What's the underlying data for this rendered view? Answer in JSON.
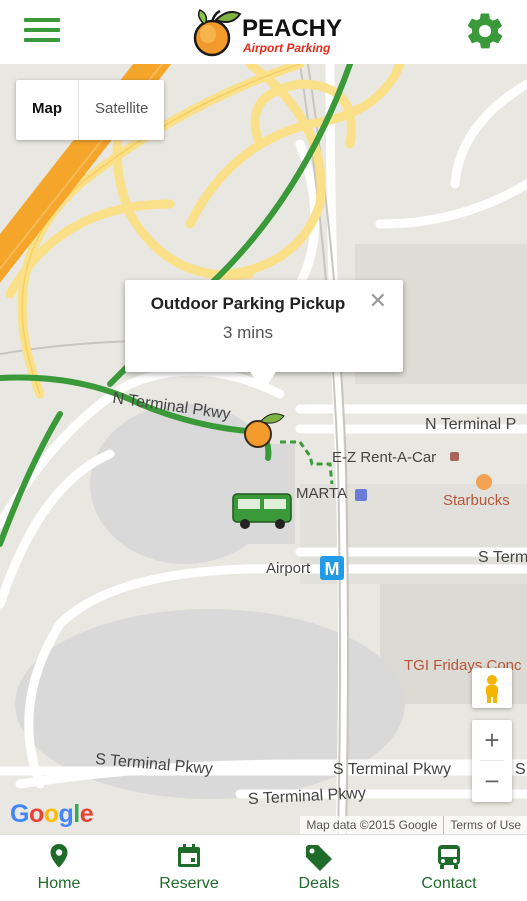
{
  "header": {
    "logo_title": "PEACHY",
    "logo_subtitle": "Airport Parking",
    "menu_icon": "hamburger-menu-icon",
    "settings_icon": "gear-icon"
  },
  "map": {
    "type_control": {
      "map_label": "Map",
      "satellite_label": "Satellite",
      "selected": "Map"
    },
    "popup": {
      "title": "Outdoor Parking Pickup",
      "subtitle": "3 mins",
      "close_label": "✕"
    },
    "labels": {
      "n_terminal_pkwy_1": "N Terminal Pkwy",
      "n_terminal_pkwy_2": "N Terminal P",
      "ez_rent": "E-Z Rent-A-Car",
      "marta": "MARTA",
      "starbucks": "Starbucks",
      "s_term": "S Term",
      "airport": "Airport",
      "tgi": "TGI Fridays Conc",
      "s_terminal_pkwy_1": "S Terminal Pkwy",
      "s_terminal_pkwy_2": "S Terminal Pkwy",
      "s_terminal_pkwy_3": "S Terminal Pkwy",
      "s_short": "S"
    },
    "zoom_in": "+",
    "zoom_out": "−",
    "google_logo": "Google",
    "attribution": "Map data ©2015 Google",
    "terms": "Terms of Use",
    "colors": {
      "route": "#3a9a3a",
      "highway": "#f4a52a",
      "major_road": "#fbe08a",
      "terrain": "#e9e7e1",
      "road": "#ffffff",
      "parking": "#d9d9d9"
    }
  },
  "bottom_nav": {
    "items": [
      {
        "label": "Home",
        "icon": "map-pin-icon"
      },
      {
        "label": "Reserve",
        "icon": "calendar-icon"
      },
      {
        "label": "Deals",
        "icon": "tag-icon"
      },
      {
        "label": "Contact",
        "icon": "bus-icon"
      }
    ],
    "color": "#1f6b2a"
  }
}
